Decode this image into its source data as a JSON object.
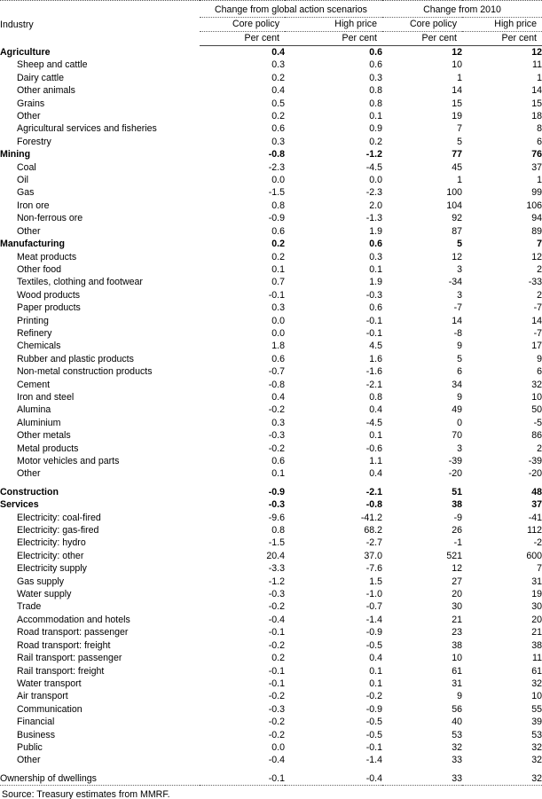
{
  "table": {
    "header": {
      "industry_label": "Industry",
      "group_left": "Change from global action scenarios",
      "group_right": "Change from 2010",
      "sub_headers": [
        "Core policy",
        "High price",
        "Core policy",
        "High price"
      ],
      "units": [
        "Per cent",
        "Per cent",
        "Per cent",
        "Per cent"
      ]
    },
    "rows": [
      {
        "label": "Agriculture",
        "bold": true,
        "indent": false,
        "values": [
          "0.4",
          "0.6",
          "12",
          "12"
        ]
      },
      {
        "label": "Sheep and cattle",
        "bold": false,
        "indent": true,
        "values": [
          "0.3",
          "0.6",
          "10",
          "11"
        ]
      },
      {
        "label": "Dairy cattle",
        "bold": false,
        "indent": true,
        "values": [
          "0.2",
          "0.3",
          "1",
          "1"
        ]
      },
      {
        "label": "Other animals",
        "bold": false,
        "indent": true,
        "values": [
          "0.4",
          "0.8",
          "14",
          "14"
        ]
      },
      {
        "label": "Grains",
        "bold": false,
        "indent": true,
        "values": [
          "0.5",
          "0.8",
          "15",
          "15"
        ]
      },
      {
        "label": "Other",
        "bold": false,
        "indent": true,
        "values": [
          "0.2",
          "0.1",
          "19",
          "18"
        ]
      },
      {
        "label": "Agricultural services and fisheries",
        "bold": false,
        "indent": true,
        "values": [
          "0.6",
          "0.9",
          "7",
          "8"
        ]
      },
      {
        "label": "Forestry",
        "bold": false,
        "indent": true,
        "values": [
          "0.3",
          "0.2",
          "5",
          "6"
        ]
      },
      {
        "label": "Mining",
        "bold": true,
        "indent": false,
        "values": [
          "-0.8",
          "-1.2",
          "77",
          "76"
        ]
      },
      {
        "label": "Coal",
        "bold": false,
        "indent": true,
        "values": [
          "-2.3",
          "-4.5",
          "45",
          "37"
        ]
      },
      {
        "label": "Oil",
        "bold": false,
        "indent": true,
        "values": [
          "0.0",
          "0.0",
          "1",
          "1"
        ]
      },
      {
        "label": "Gas",
        "bold": false,
        "indent": true,
        "values": [
          "-1.5",
          "-2.3",
          "100",
          "99"
        ]
      },
      {
        "label": "Iron ore",
        "bold": false,
        "indent": true,
        "values": [
          "0.8",
          "2.0",
          "104",
          "106"
        ]
      },
      {
        "label": "Non-ferrous ore",
        "bold": false,
        "indent": true,
        "values": [
          "-0.9",
          "-1.3",
          "92",
          "94"
        ]
      },
      {
        "label": "Other",
        "bold": false,
        "indent": true,
        "values": [
          "0.6",
          "1.9",
          "87",
          "89"
        ]
      },
      {
        "label": "Manufacturing",
        "bold": true,
        "indent": false,
        "values": [
          "0.2",
          "0.6",
          "5",
          "7"
        ]
      },
      {
        "label": "Meat products",
        "bold": false,
        "indent": true,
        "values": [
          "0.2",
          "0.3",
          "12",
          "12"
        ]
      },
      {
        "label": "Other food",
        "bold": false,
        "indent": true,
        "values": [
          "0.1",
          "0.1",
          "3",
          "2"
        ]
      },
      {
        "label": "Textiles, clothing and footwear",
        "bold": false,
        "indent": true,
        "values": [
          "0.7",
          "1.9",
          "-34",
          "-33"
        ]
      },
      {
        "label": "Wood products",
        "bold": false,
        "indent": true,
        "values": [
          "-0.1",
          "-0.3",
          "3",
          "2"
        ]
      },
      {
        "label": "Paper products",
        "bold": false,
        "indent": true,
        "values": [
          "0.3",
          "0.6",
          "-7",
          "-7"
        ]
      },
      {
        "label": "Printing",
        "bold": false,
        "indent": true,
        "values": [
          "0.0",
          "-0.1",
          "14",
          "14"
        ]
      },
      {
        "label": "Refinery",
        "bold": false,
        "indent": true,
        "values": [
          "0.0",
          "-0.1",
          "-8",
          "-7"
        ]
      },
      {
        "label": "Chemicals",
        "bold": false,
        "indent": true,
        "values": [
          "1.8",
          "4.5",
          "9",
          "17"
        ]
      },
      {
        "label": "Rubber and plastic products",
        "bold": false,
        "indent": true,
        "values": [
          "0.6",
          "1.6",
          "5",
          "9"
        ]
      },
      {
        "label": "Non-metal construction products",
        "bold": false,
        "indent": true,
        "values": [
          "-0.7",
          "-1.6",
          "6",
          "6"
        ]
      },
      {
        "label": "Cement",
        "bold": false,
        "indent": true,
        "values": [
          "-0.8",
          "-2.1",
          "34",
          "32"
        ]
      },
      {
        "label": "Iron and steel",
        "bold": false,
        "indent": true,
        "values": [
          "0.4",
          "0.8",
          "9",
          "10"
        ]
      },
      {
        "label": "Alumina",
        "bold": false,
        "indent": true,
        "values": [
          "-0.2",
          "0.4",
          "49",
          "50"
        ]
      },
      {
        "label": "Aluminium",
        "bold": false,
        "indent": true,
        "values": [
          "0.3",
          "-4.5",
          "0",
          "-5"
        ]
      },
      {
        "label": "Other metals",
        "bold": false,
        "indent": true,
        "values": [
          "-0.3",
          "0.1",
          "70",
          "86"
        ]
      },
      {
        "label": "Metal products",
        "bold": false,
        "indent": true,
        "values": [
          "-0.2",
          "-0.6",
          "3",
          "2"
        ]
      },
      {
        "label": "Motor vehicles and parts",
        "bold": false,
        "indent": true,
        "values": [
          "0.6",
          "1.1",
          "-39",
          "-39"
        ]
      },
      {
        "label": "Other",
        "bold": false,
        "indent": true,
        "values": [
          "0.1",
          "0.4",
          "-20",
          "-20"
        ]
      },
      {
        "label": "Construction",
        "bold": true,
        "indent": false,
        "gap_before": true,
        "values": [
          "-0.9",
          "-2.1",
          "51",
          "48"
        ]
      },
      {
        "label": "Services",
        "bold": true,
        "indent": false,
        "values": [
          "-0.3",
          "-0.8",
          "38",
          "37"
        ]
      },
      {
        "label": "Electricity: coal-fired",
        "bold": false,
        "indent": true,
        "values": [
          "-9.6",
          "-41.2",
          "-9",
          "-41"
        ]
      },
      {
        "label": "Electricity: gas-fired",
        "bold": false,
        "indent": true,
        "values": [
          "0.8",
          "68.2",
          "26",
          "112"
        ]
      },
      {
        "label": "Electricity: hydro",
        "bold": false,
        "indent": true,
        "values": [
          "-1.5",
          "-2.7",
          "-1",
          "-2"
        ]
      },
      {
        "label": "Electricity: other",
        "bold": false,
        "indent": true,
        "values": [
          "20.4",
          "37.0",
          "521",
          "600"
        ]
      },
      {
        "label": "Electricity supply",
        "bold": false,
        "indent": true,
        "values": [
          "-3.3",
          "-7.6",
          "12",
          "7"
        ]
      },
      {
        "label": "Gas supply",
        "bold": false,
        "indent": true,
        "values": [
          "-1.2",
          "1.5",
          "27",
          "31"
        ]
      },
      {
        "label": "Water supply",
        "bold": false,
        "indent": true,
        "values": [
          "-0.3",
          "-1.0",
          "20",
          "19"
        ]
      },
      {
        "label": "Trade",
        "bold": false,
        "indent": true,
        "values": [
          "-0.2",
          "-0.7",
          "30",
          "30"
        ]
      },
      {
        "label": "Accommodation and hotels",
        "bold": false,
        "indent": true,
        "values": [
          "-0.4",
          "-1.4",
          "21",
          "20"
        ]
      },
      {
        "label": "Road transport: passenger",
        "bold": false,
        "indent": true,
        "values": [
          "-0.1",
          "-0.9",
          "23",
          "21"
        ]
      },
      {
        "label": "Road transport: freight",
        "bold": false,
        "indent": true,
        "values": [
          "-0.2",
          "-0.5",
          "38",
          "38"
        ]
      },
      {
        "label": "Rail transport: passenger",
        "bold": false,
        "indent": true,
        "values": [
          "0.2",
          "0.4",
          "10",
          "11"
        ]
      },
      {
        "label": "Rail transport: freight",
        "bold": false,
        "indent": true,
        "values": [
          "-0.1",
          "0.1",
          "61",
          "61"
        ]
      },
      {
        "label": "Water transport",
        "bold": false,
        "indent": true,
        "values": [
          "-0.1",
          "0.1",
          "31",
          "32"
        ]
      },
      {
        "label": "Air transport",
        "bold": false,
        "indent": true,
        "values": [
          "-0.2",
          "-0.2",
          "9",
          "10"
        ]
      },
      {
        "label": "Communication",
        "bold": false,
        "indent": true,
        "values": [
          "-0.3",
          "-0.9",
          "56",
          "55"
        ]
      },
      {
        "label": "Financial",
        "bold": false,
        "indent": true,
        "values": [
          "-0.2",
          "-0.5",
          "40",
          "39"
        ]
      },
      {
        "label": "Business",
        "bold": false,
        "indent": true,
        "values": [
          "-0.2",
          "-0.5",
          "53",
          "53"
        ]
      },
      {
        "label": "Public",
        "bold": false,
        "indent": true,
        "values": [
          "0.0",
          "-0.1",
          "32",
          "32"
        ]
      },
      {
        "label": "Other",
        "bold": false,
        "indent": true,
        "values": [
          "-0.4",
          "-1.4",
          "33",
          "32"
        ]
      },
      {
        "label": "Ownership of dwellings",
        "bold": false,
        "indent": false,
        "gap_before": true,
        "values": [
          "-0.1",
          "-0.4",
          "33",
          "32"
        ]
      }
    ],
    "source": "Source: Treasury estimates from MMRF."
  }
}
